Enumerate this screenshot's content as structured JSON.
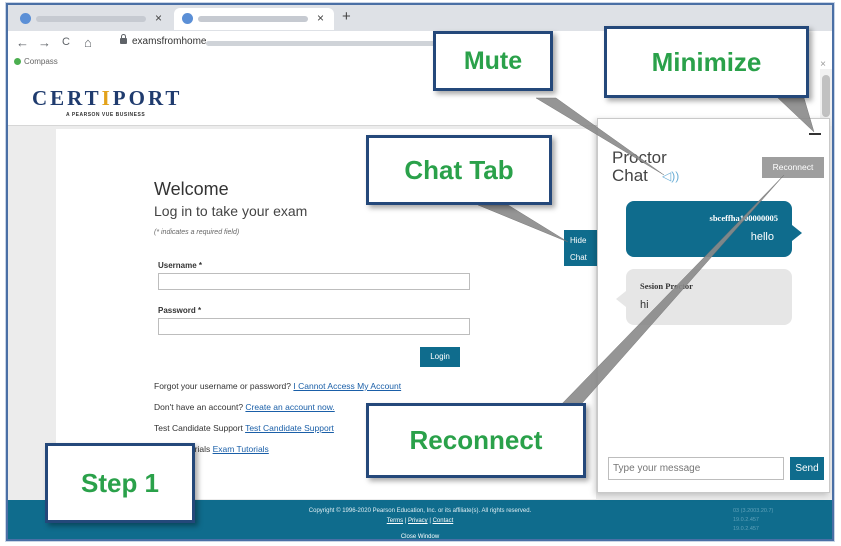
{
  "browser": {
    "tab_close": "×",
    "new_tab": "+",
    "nav_back": "←",
    "nav_forward": "→",
    "nav_reload": "C",
    "nav_home": "⌂",
    "url": "examsfromhome.",
    "bookmark": "Compass"
  },
  "header": {
    "logo_pre": "CERT",
    "logo_i": "I",
    "logo_post": "PORT",
    "logo_sub": "A PEARSON VUE BUSINESS"
  },
  "login": {
    "welcome": "Welcome",
    "subtitle": "Log in to take your exam",
    "required_note": "(* indicates a required field)",
    "username_label": "Username *",
    "password_label": "Password *",
    "login_button": "Login",
    "forgot_text": "Forgot your username or password?",
    "forgot_link": "I Cannot Access My Account",
    "no_account_text": "Don't have an account?",
    "create_link": "Create an account now.",
    "support_text": "Test Candidate Support",
    "support_link": "Test Candidate Support",
    "tutorials_text": "Exam Tutorials",
    "tutorials_link": "Exam Tutorials"
  },
  "footer": {
    "copyright": "Copyright © 1996-2020 Pearson Education, Inc. or its affiliate(s). All rights reserved.",
    "terms": "Terms",
    "privacy": "Privacy",
    "contact": "Contact",
    "sep": "|",
    "close_window": "Close Window",
    "version1": "03 (3.2003.20.7)",
    "version2": "19.0.2.457",
    "version3": "19.0.2.457"
  },
  "chat": {
    "title_line1": "Proctor",
    "title_line2": "Chat",
    "speaker_icon": "speaker-icon",
    "reconnect_button": "Reconnect",
    "hide_tab_line1": "Hide",
    "hide_tab_line2": "Chat",
    "messages": [
      {
        "sender": "sbceffha100000005",
        "text": "hello"
      },
      {
        "sender": "Sesion Proctor",
        "text": "hi"
      }
    ],
    "input_placeholder": "Type your message",
    "send_button": "Send"
  },
  "callouts": {
    "mute": "Mute",
    "minimize": "Minimize",
    "chat_tab": "Chat Tab",
    "reconnect": "Reconnect",
    "step": "Step 1"
  },
  "colors": {
    "teal": "#0f6c8d",
    "callout_border": "#24487a",
    "callout_text": "#2aa14a"
  }
}
